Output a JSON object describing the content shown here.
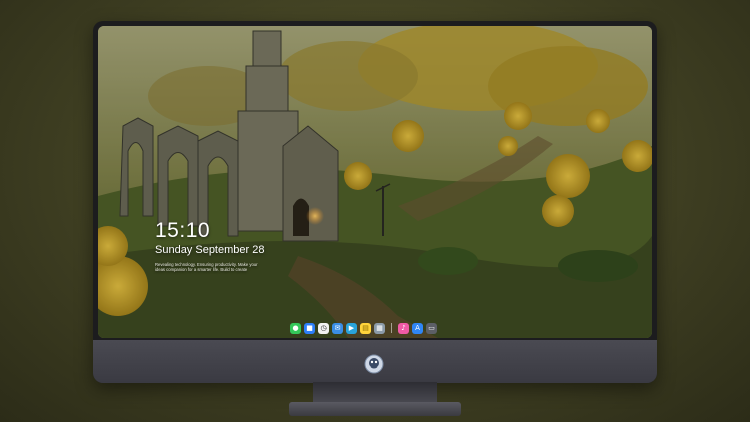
{
  "lockscreen": {
    "time": "15:10",
    "date": "Sunday September 28",
    "tagline": "Revealing technology. Ensuring productivity. Make your ideas companion for a smarter life. Build to create"
  },
  "dock": {
    "apps": [
      {
        "name": "messages-icon",
        "color": "#34c759",
        "glyph": "●"
      },
      {
        "name": "finder-icon",
        "color": "#2d7ff9",
        "glyph": "■"
      },
      {
        "name": "clock-icon",
        "color": "#f2f2f2",
        "glyph": "◷"
      },
      {
        "name": "mail-icon",
        "color": "#3a8ee6",
        "glyph": "✉"
      },
      {
        "name": "clapper-icon",
        "color": "#29a3d9",
        "glyph": "▶"
      },
      {
        "name": "notes-icon",
        "color": "#ffd43b",
        "glyph": "▤"
      },
      {
        "name": "photos-icon",
        "color": "#8b9aa8",
        "glyph": "▦"
      },
      {
        "name": "music-icon",
        "color": "#f05aa6",
        "glyph": "♪"
      },
      {
        "name": "app-store-icon",
        "color": "#2f86f5",
        "glyph": "A"
      },
      {
        "name": "folder-icon",
        "color": "#5c5f66",
        "glyph": "▭"
      }
    ]
  },
  "colors": {
    "bezel": "#1c1c1e",
    "chin": "#3a3a42",
    "background": "#3f3f22"
  }
}
